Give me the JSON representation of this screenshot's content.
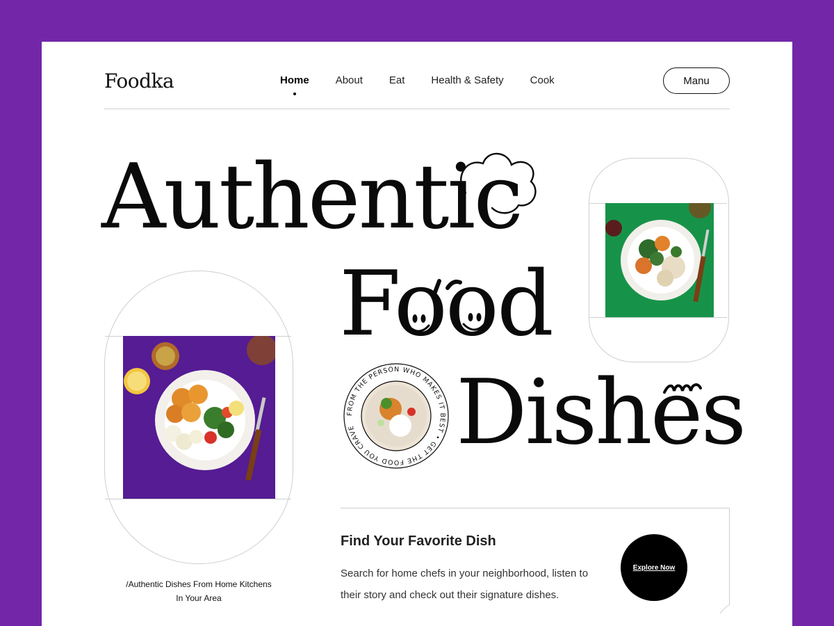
{
  "brand": {
    "logo": "Foodka"
  },
  "nav": {
    "items": [
      {
        "label": "Home",
        "active": true
      },
      {
        "label": "About",
        "active": false
      },
      {
        "label": "Eat",
        "active": false
      },
      {
        "label": "Health & Safety",
        "active": false
      },
      {
        "label": "Cook",
        "active": false
      }
    ],
    "menu_button": "Manu"
  },
  "hero": {
    "line1": "Authentic",
    "line2": "Food",
    "line3": "Dishes",
    "caption": "/Authentic Dishes From Home Kitchens In Your Area",
    "badge_text": "FROM THE PERSON WHO MAKES IT BEST • GET THE FOOD YOU CRAVE"
  },
  "info": {
    "title": "Find Your Favorite Dish",
    "body": "Search for home chefs in your neighborhood, listen to their story and check out their signature dishes.",
    "cta": "Explore Now"
  },
  "colors": {
    "frame": "#7327a8",
    "page": "#ffffff",
    "ink": "#0a0a0a",
    "photo_left_bg": "#5a1f9a",
    "photo_right_bg": "#179349"
  }
}
